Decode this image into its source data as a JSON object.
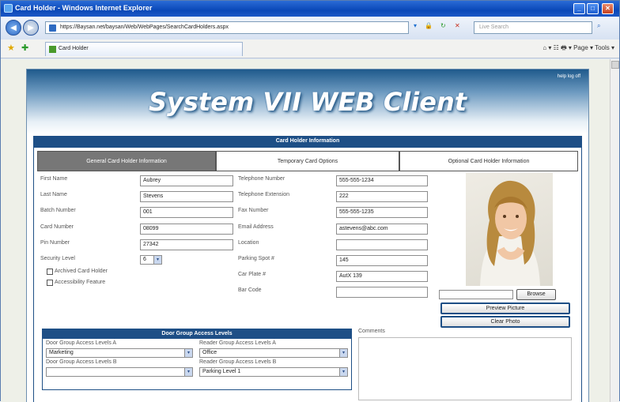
{
  "window": {
    "title": "Card Holder - Windows Internet Explorer"
  },
  "browser": {
    "url": "https://Baysan.net/baysan/Web/WebPages/SearchCardHolders.aspx",
    "search_placeholder": "Live Search",
    "tab": "Card Holder",
    "commands": "Page ▾  Tools ▾"
  },
  "page": {
    "links": "help   log off",
    "title": "System VII WEB Client",
    "section": "Card Holder Information",
    "tabs": [
      "General Card Holder Information",
      "Temporary Card Options",
      "Optional Card Holder Information"
    ]
  },
  "form": {
    "first_name": {
      "label": "First Name",
      "value": "Aubrey"
    },
    "last_name": {
      "label": "Last Name",
      "value": "Stevens"
    },
    "batch_number": {
      "label": "Batch Number",
      "value": "001"
    },
    "card_number": {
      "label": "Card Number",
      "value": "08099"
    },
    "pin_number": {
      "label": "Pin Number",
      "value": "27342"
    },
    "security_level": {
      "label": "Security Level",
      "value": "6"
    },
    "archived": {
      "label": "Archived Card Holder"
    },
    "accessibility": {
      "label": "Accessibility Feature"
    },
    "telephone": {
      "label": "Telephone Number",
      "value": "555-555-1234"
    },
    "extension": {
      "label": "Telephone Extension",
      "value": "222"
    },
    "fax": {
      "label": "Fax Number",
      "value": "555-555-1235"
    },
    "email": {
      "label": "Email Address",
      "value": "astevens@abc.com"
    },
    "location": {
      "label": "Location",
      "value": ""
    },
    "parking_spot": {
      "label": "Parking Spot #",
      "value": "145"
    },
    "car_plate": {
      "label": "Car Plate #",
      "value": "AutX 139"
    },
    "bar_code": {
      "label": "Bar Code",
      "value": ""
    }
  },
  "photo": {
    "browse": "Browse",
    "preview": "Preview Picture",
    "clear": "Clear Photo"
  },
  "door_groups": {
    "title": "Door Group Access Levels",
    "a_label": "Door Group Access Levels A",
    "a_value": "Marketing",
    "b_label": "Door Group Access Levels B",
    "b_value": "",
    "ra_label": "Reader Group Access Levels A",
    "ra_value": "Office",
    "rb_label": "Reader Group Access Levels B",
    "rb_value": "Parking Level 1"
  },
  "comments": {
    "label": "Comments"
  }
}
